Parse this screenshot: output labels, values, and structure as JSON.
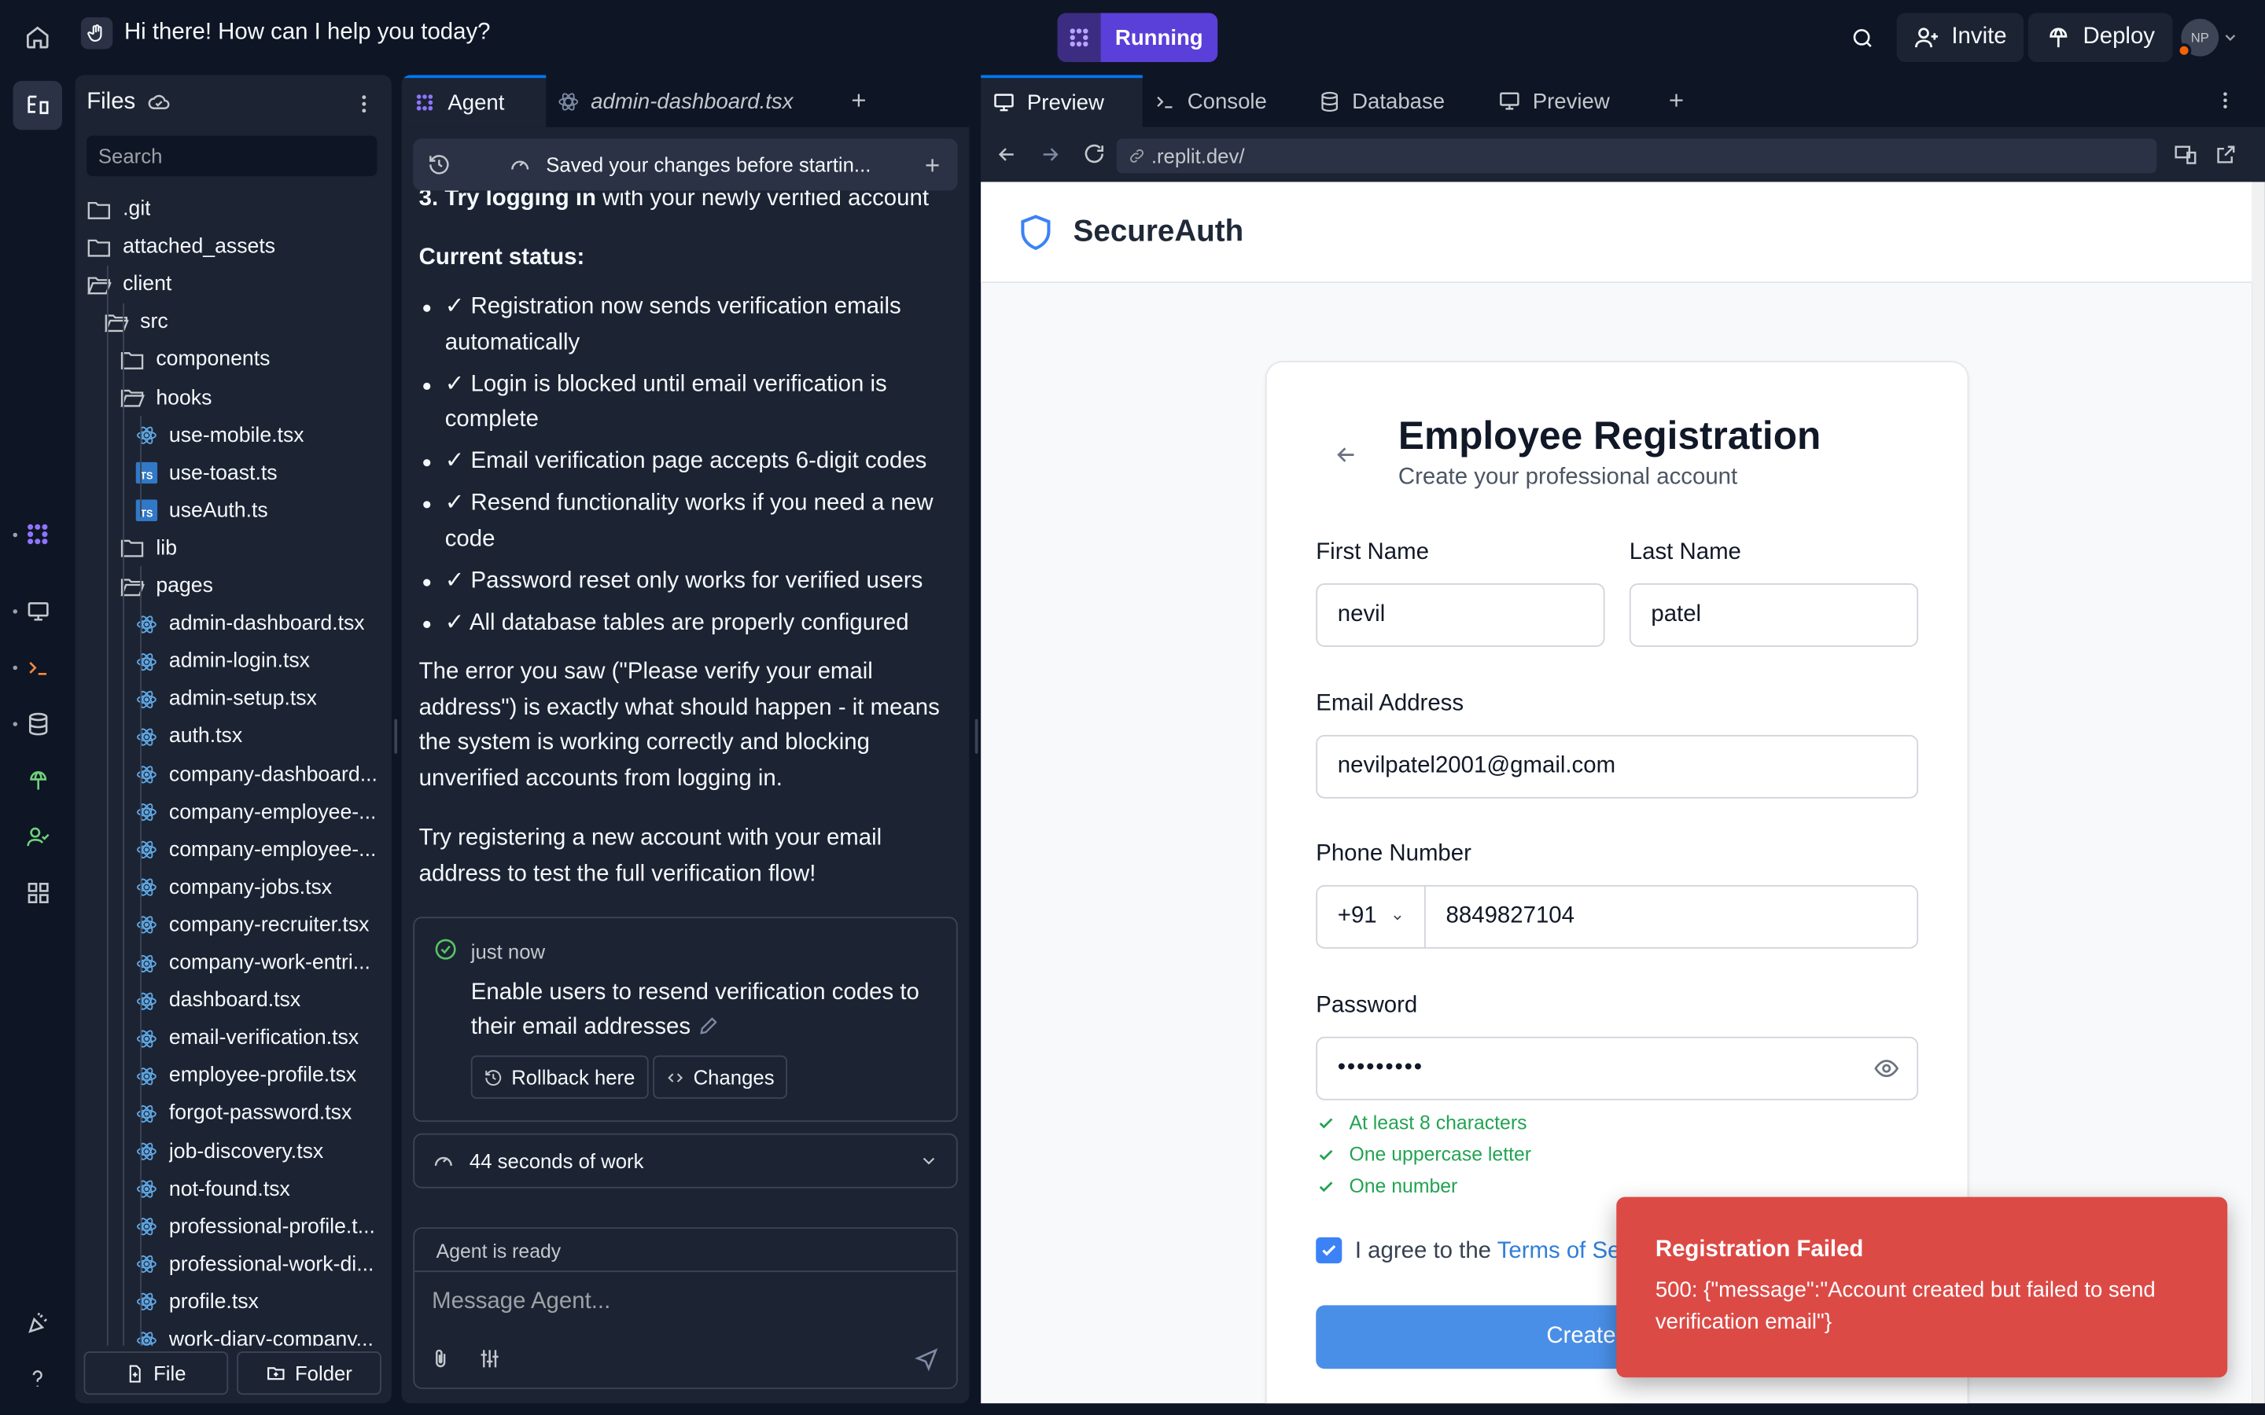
{
  "topbar": {
    "project_title": "Hi there! How can I help you today?",
    "run_label": "Running",
    "invite_label": "Invite",
    "deploy_label": "Deploy",
    "avatar_initials": "NP"
  },
  "files": {
    "title": "Files",
    "search_placeholder": "Search",
    "tree": [
      {
        "name": ".git",
        "kind": "folder",
        "depth": 0
      },
      {
        "name": "attached_assets",
        "kind": "folder",
        "depth": 0
      },
      {
        "name": "client",
        "kind": "folder-open",
        "depth": 0
      },
      {
        "name": "src",
        "kind": "folder-open",
        "depth": 1
      },
      {
        "name": "components",
        "kind": "folder",
        "depth": 2
      },
      {
        "name": "hooks",
        "kind": "folder-open",
        "depth": 2
      },
      {
        "name": "use-mobile.tsx",
        "kind": "react",
        "depth": 3
      },
      {
        "name": "use-toast.ts",
        "kind": "ts",
        "depth": 3
      },
      {
        "name": "useAuth.ts",
        "kind": "ts",
        "depth": 3
      },
      {
        "name": "lib",
        "kind": "folder",
        "depth": 2
      },
      {
        "name": "pages",
        "kind": "folder-open",
        "depth": 2
      },
      {
        "name": "admin-dashboard.tsx",
        "kind": "react",
        "depth": 3
      },
      {
        "name": "admin-login.tsx",
        "kind": "react",
        "depth": 3
      },
      {
        "name": "admin-setup.tsx",
        "kind": "react",
        "depth": 3
      },
      {
        "name": "auth.tsx",
        "kind": "react",
        "depth": 3
      },
      {
        "name": "company-dashboard...",
        "kind": "react",
        "depth": 3
      },
      {
        "name": "company-employee-...",
        "kind": "react",
        "depth": 3
      },
      {
        "name": "company-employee-...",
        "kind": "react",
        "depth": 3
      },
      {
        "name": "company-jobs.tsx",
        "kind": "react",
        "depth": 3
      },
      {
        "name": "company-recruiter.tsx",
        "kind": "react",
        "depth": 3
      },
      {
        "name": "company-work-entri...",
        "kind": "react",
        "depth": 3
      },
      {
        "name": "dashboard.tsx",
        "kind": "react",
        "depth": 3
      },
      {
        "name": "email-verification.tsx",
        "kind": "react",
        "depth": 3
      },
      {
        "name": "employee-profile.tsx",
        "kind": "react",
        "depth": 3
      },
      {
        "name": "forgot-password.tsx",
        "kind": "react",
        "depth": 3
      },
      {
        "name": "job-discovery.tsx",
        "kind": "react",
        "depth": 3
      },
      {
        "name": "not-found.tsx",
        "kind": "react",
        "depth": 3
      },
      {
        "name": "professional-profile.t...",
        "kind": "react",
        "depth": 3
      },
      {
        "name": "professional-work-di...",
        "kind": "react",
        "depth": 3
      },
      {
        "name": "profile.tsx",
        "kind": "react",
        "depth": 3
      },
      {
        "name": "work-diary-company...",
        "kind": "react",
        "depth": 3
      }
    ],
    "new_file_label": "File",
    "new_folder_label": "Folder"
  },
  "agent_panel": {
    "tabs": [
      {
        "label": "Agent"
      },
      {
        "label": "admin-dashboard.tsx"
      }
    ],
    "saved_banner": "Saved your changes before startin...",
    "partial_line_bold": "3. Try logging in",
    "partial_line_rest": " with your newly verified account",
    "status_heading": "Current status:",
    "status_items": [
      "✓ Registration now sends verification emails automatically",
      "✓ Login is blocked until email verification is complete",
      "✓ Email verification page accepts 6-digit codes",
      "✓ Resend functionality works if you need a new code",
      "✓ Password reset only works for verified users",
      "✓ All database tables are properly configured"
    ],
    "paragraph_1": "The error you saw (\"Please verify your email address\") is exactly what should happen - it means the system is working correctly and blocking unverified accounts from logging in.",
    "paragraph_2": "Try registering a new account with your email address to test the full verification flow!",
    "checkpoint": {
      "time": "just now",
      "title": "Enable users to resend verification codes to their email addresses",
      "rollback_label": "Rollback here",
      "changes_label": "Changes"
    },
    "work_summary": "44 seconds of work",
    "composer": {
      "status": "Agent is ready",
      "placeholder": "Message Agent..."
    }
  },
  "preview_panel": {
    "tabs": [
      {
        "label": "Preview"
      },
      {
        "label": "Console"
      },
      {
        "label": "Database"
      },
      {
        "label": "Preview"
      }
    ],
    "url": ".replit.dev/"
  },
  "site": {
    "brand": "SecureAuth",
    "form": {
      "title": "Employee Registration",
      "subtitle": "Create your professional account",
      "first_name_label": "First Name",
      "first_name_value": "nevil",
      "last_name_label": "Last Name",
      "last_name_value": "patel",
      "email_label": "Email Address",
      "email_value": "nevilpatel2001@gmail.com",
      "phone_label": "Phone Number",
      "country_code": "+91",
      "phone_value": "8849827104",
      "password_label": "Password",
      "password_value": "•••••••••",
      "rules": [
        "At least 8 characters",
        "One uppercase letter",
        "One number"
      ],
      "agree_prefix": "I agree to the ",
      "terms_link": "Terms of Se",
      "submit_label": "Create Emplo"
    }
  },
  "toast": {
    "title": "Registration Failed",
    "message": "500: {\"message\":\"Account created but failed to send verification email\"}"
  },
  "colors": {
    "bg": "#0e1525",
    "panel": "#1c2333",
    "run_accent": "#5b3fd9",
    "toast": "#dc4a46",
    "link_blue": "#2f7ed8",
    "rule_green": "#22a352"
  }
}
